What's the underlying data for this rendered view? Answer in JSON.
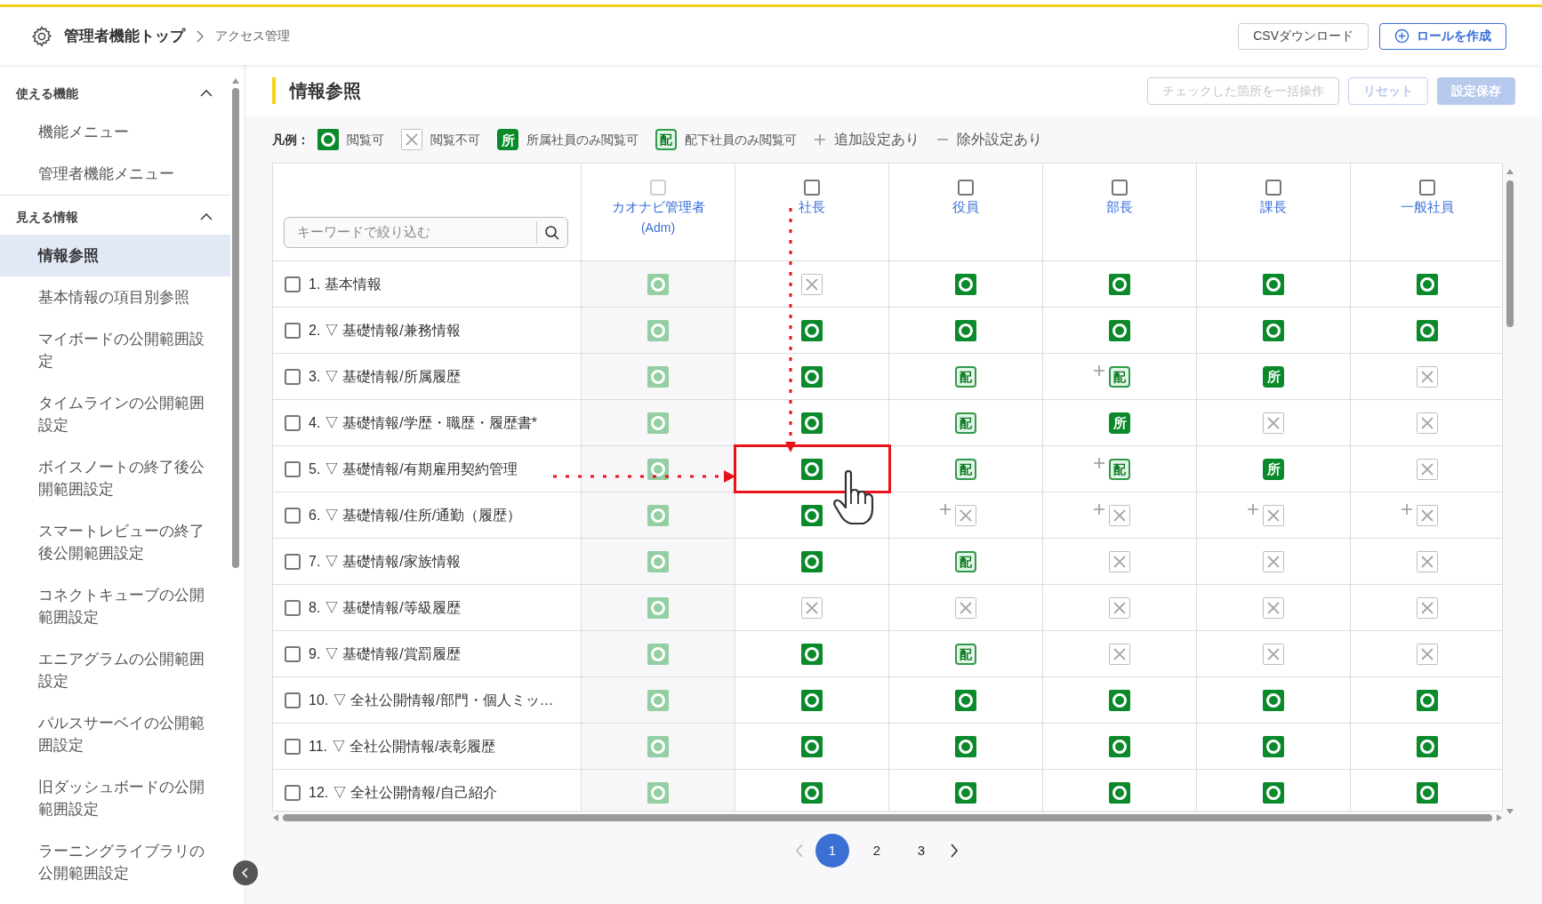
{
  "breadcrumb": {
    "home": "管理者機能トップ",
    "current": "アクセス管理"
  },
  "header_buttons": [
    {
      "kind": "outline",
      "label": "CSVダウンロード"
    },
    {
      "kind": "create",
      "label": "ロールを作成"
    }
  ],
  "sidebar": {
    "sections": [
      {
        "title": "使える機能",
        "expanded": true,
        "items": [
          {
            "label": "機能メニュー",
            "selected": false
          },
          {
            "label": "管理者機能メニュー",
            "selected": false
          }
        ]
      },
      {
        "title": "見える情報",
        "expanded": true,
        "items": [
          {
            "label": "情報参照",
            "selected": true
          },
          {
            "label": "基本情報の項目別参照",
            "selected": false
          },
          {
            "label": "マイボードの公開範囲設定",
            "selected": false
          },
          {
            "label": "タイムラインの公開範囲設定",
            "selected": false
          },
          {
            "label": "ボイスノートの終了後公開範囲設定",
            "selected": false
          },
          {
            "label": "スマートレビューの終了後公開範囲設定",
            "selected": false
          },
          {
            "label": "コネクトキューブの公開範囲設定",
            "selected": false
          },
          {
            "label": "エニアグラムの公開範囲設定",
            "selected": false
          },
          {
            "label": "パルスサーベイの公開範囲設定",
            "selected": false
          },
          {
            "label": "旧ダッシュボードの公開範囲設定",
            "selected": false
          },
          {
            "label": "ラーニングライブラリの公開範囲設定",
            "selected": false
          }
        ]
      }
    ]
  },
  "page_title": "情報参照",
  "actions": [
    {
      "kind": "outline",
      "label": "チェックした箇所を一括操作",
      "disabled": true
    },
    {
      "kind": "blue_outline",
      "label": "リセット",
      "disabled": true
    },
    {
      "kind": "primary",
      "label": "設定保存",
      "disabled": true
    }
  ],
  "legend": {
    "title": "凡例：",
    "items": [
      {
        "kind": "ok",
        "label": "閲覧可"
      },
      {
        "kind": "ng",
        "label": "閲覧不可"
      },
      {
        "kind": "sho",
        "glyph": "所",
        "label": "所属社員のみ閲覧可"
      },
      {
        "kind": "hai",
        "glyph": "配",
        "label": "配下社員のみ閲覧可"
      },
      {
        "kind": "plus",
        "label": "追加設定あり"
      },
      {
        "kind": "minus",
        "label": "除外設定あり"
      }
    ]
  },
  "table": {
    "search": {
      "placeholder": "キーワードで絞り込む"
    },
    "columns": [
      {
        "name": "カオナビ管理者",
        "sub": "(Adm)",
        "checked": false,
        "disabled": true
      },
      {
        "name": "社長",
        "checked": false,
        "disabled": false
      },
      {
        "name": "役員",
        "checked": false,
        "disabled": false
      },
      {
        "name": "部長",
        "checked": false,
        "disabled": false
      },
      {
        "name": "課長",
        "checked": false,
        "disabled": false
      },
      {
        "name": "一般社員",
        "checked": false,
        "disabled": false
      }
    ],
    "rows": [
      {
        "label": "1. 基本情報",
        "checked": false,
        "cells": [
          {
            "kind": "ok"
          },
          {
            "kind": "ng"
          },
          {
            "kind": "ok"
          },
          {
            "kind": "ok"
          },
          {
            "kind": "ok"
          },
          {
            "kind": "ok"
          }
        ]
      },
      {
        "label": "2. ▽ 基礎情報/兼務情報",
        "checked": false,
        "cells": [
          {
            "kind": "ok"
          },
          {
            "kind": "ok"
          },
          {
            "kind": "ok"
          },
          {
            "kind": "ok"
          },
          {
            "kind": "ok"
          },
          {
            "kind": "ok"
          }
        ]
      },
      {
        "label": "3. ▽ 基礎情報/所属履歴",
        "checked": false,
        "cells": [
          {
            "kind": "ok"
          },
          {
            "kind": "ok"
          },
          {
            "kind": "hai",
            "glyph": "配"
          },
          {
            "kind": "hai",
            "glyph": "配",
            "added": true
          },
          {
            "kind": "sho",
            "glyph": "所"
          },
          {
            "kind": "ng"
          }
        ]
      },
      {
        "label": "4. ▽ 基礎情報/学歴・職歴・履歴書*",
        "checked": false,
        "cells": [
          {
            "kind": "ok"
          },
          {
            "kind": "ok"
          },
          {
            "kind": "hai",
            "glyph": "配"
          },
          {
            "kind": "sho",
            "glyph": "所"
          },
          {
            "kind": "ng"
          },
          {
            "kind": "ng"
          }
        ]
      },
      {
        "label": "5. ▽ 基礎情報/有期雇用契約管理",
        "checked": false,
        "cells": [
          {
            "kind": "ok"
          },
          {
            "kind": "ok",
            "highlighted": true
          },
          {
            "kind": "hai",
            "glyph": "配"
          },
          {
            "kind": "hai",
            "glyph": "配",
            "added": true
          },
          {
            "kind": "sho",
            "glyph": "所"
          },
          {
            "kind": "ng"
          }
        ]
      },
      {
        "label": "6. ▽ 基礎情報/住所/通勤（履歴）",
        "checked": false,
        "cells": [
          {
            "kind": "ok"
          },
          {
            "kind": "ok"
          },
          {
            "kind": "ng",
            "added": true
          },
          {
            "kind": "ng",
            "added": true
          },
          {
            "kind": "ng",
            "added": true
          },
          {
            "kind": "ng",
            "added": true
          }
        ]
      },
      {
        "label": "7. ▽ 基礎情報/家族情報",
        "checked": false,
        "cells": [
          {
            "kind": "ok"
          },
          {
            "kind": "ok"
          },
          {
            "kind": "hai",
            "glyph": "配"
          },
          {
            "kind": "ng"
          },
          {
            "kind": "ng"
          },
          {
            "kind": "ng"
          }
        ]
      },
      {
        "label": "8. ▽ 基礎情報/等級履歴",
        "checked": false,
        "cells": [
          {
            "kind": "ok"
          },
          {
            "kind": "ng"
          },
          {
            "kind": "ng"
          },
          {
            "kind": "ng"
          },
          {
            "kind": "ng"
          },
          {
            "kind": "ng"
          }
        ]
      },
      {
        "label": "9. ▽ 基礎情報/賞罰履歴",
        "checked": false,
        "cells": [
          {
            "kind": "ok"
          },
          {
            "kind": "ok"
          },
          {
            "kind": "hai",
            "glyph": "配"
          },
          {
            "kind": "ng"
          },
          {
            "kind": "ng"
          },
          {
            "kind": "ng"
          }
        ]
      },
      {
        "label": "10. ▽ 全社公開情報/部門・個人ミッ…",
        "checked": false,
        "cells": [
          {
            "kind": "ok"
          },
          {
            "kind": "ok"
          },
          {
            "kind": "ok"
          },
          {
            "kind": "ok"
          },
          {
            "kind": "ok"
          },
          {
            "kind": "ok"
          }
        ]
      },
      {
        "label": "11. ▽ 全社公開情報/表彰履歴",
        "checked": false,
        "cells": [
          {
            "kind": "ok"
          },
          {
            "kind": "ok"
          },
          {
            "kind": "ok"
          },
          {
            "kind": "ok"
          },
          {
            "kind": "ok"
          },
          {
            "kind": "ok"
          }
        ]
      },
      {
        "label": "12. ▽ 全社公開情報/自己紹介",
        "checked": false,
        "cells": [
          {
            "kind": "ok"
          },
          {
            "kind": "ok"
          },
          {
            "kind": "ok"
          },
          {
            "kind": "ok"
          },
          {
            "kind": "ok"
          },
          {
            "kind": "ok"
          }
        ]
      }
    ]
  },
  "pagination": {
    "pages": [
      {
        "label": "1",
        "selected": true
      },
      {
        "label": "2",
        "selected": false
      },
      {
        "label": "3",
        "selected": false
      }
    ]
  }
}
